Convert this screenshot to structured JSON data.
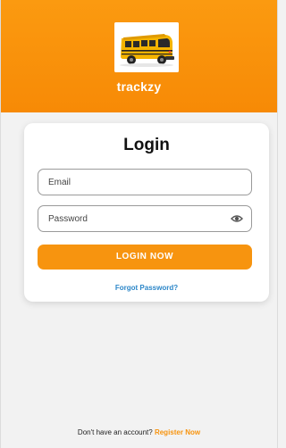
{
  "app": {
    "name": "trackzy",
    "logo_icon": "school-bus-icon"
  },
  "login": {
    "title": "Login",
    "email_placeholder": "Email",
    "password_placeholder": "Password",
    "password_toggle_icon": "eye-icon",
    "submit_label": "LOGIN NOW",
    "forgot_label": "Forgot Password?"
  },
  "footer": {
    "prompt": "Don't have an account?",
    "register_label": "Register Now"
  },
  "colors": {
    "brand_orange": "#f7940f",
    "link_blue": "#2b86c8",
    "background": "#f2f2f2"
  }
}
